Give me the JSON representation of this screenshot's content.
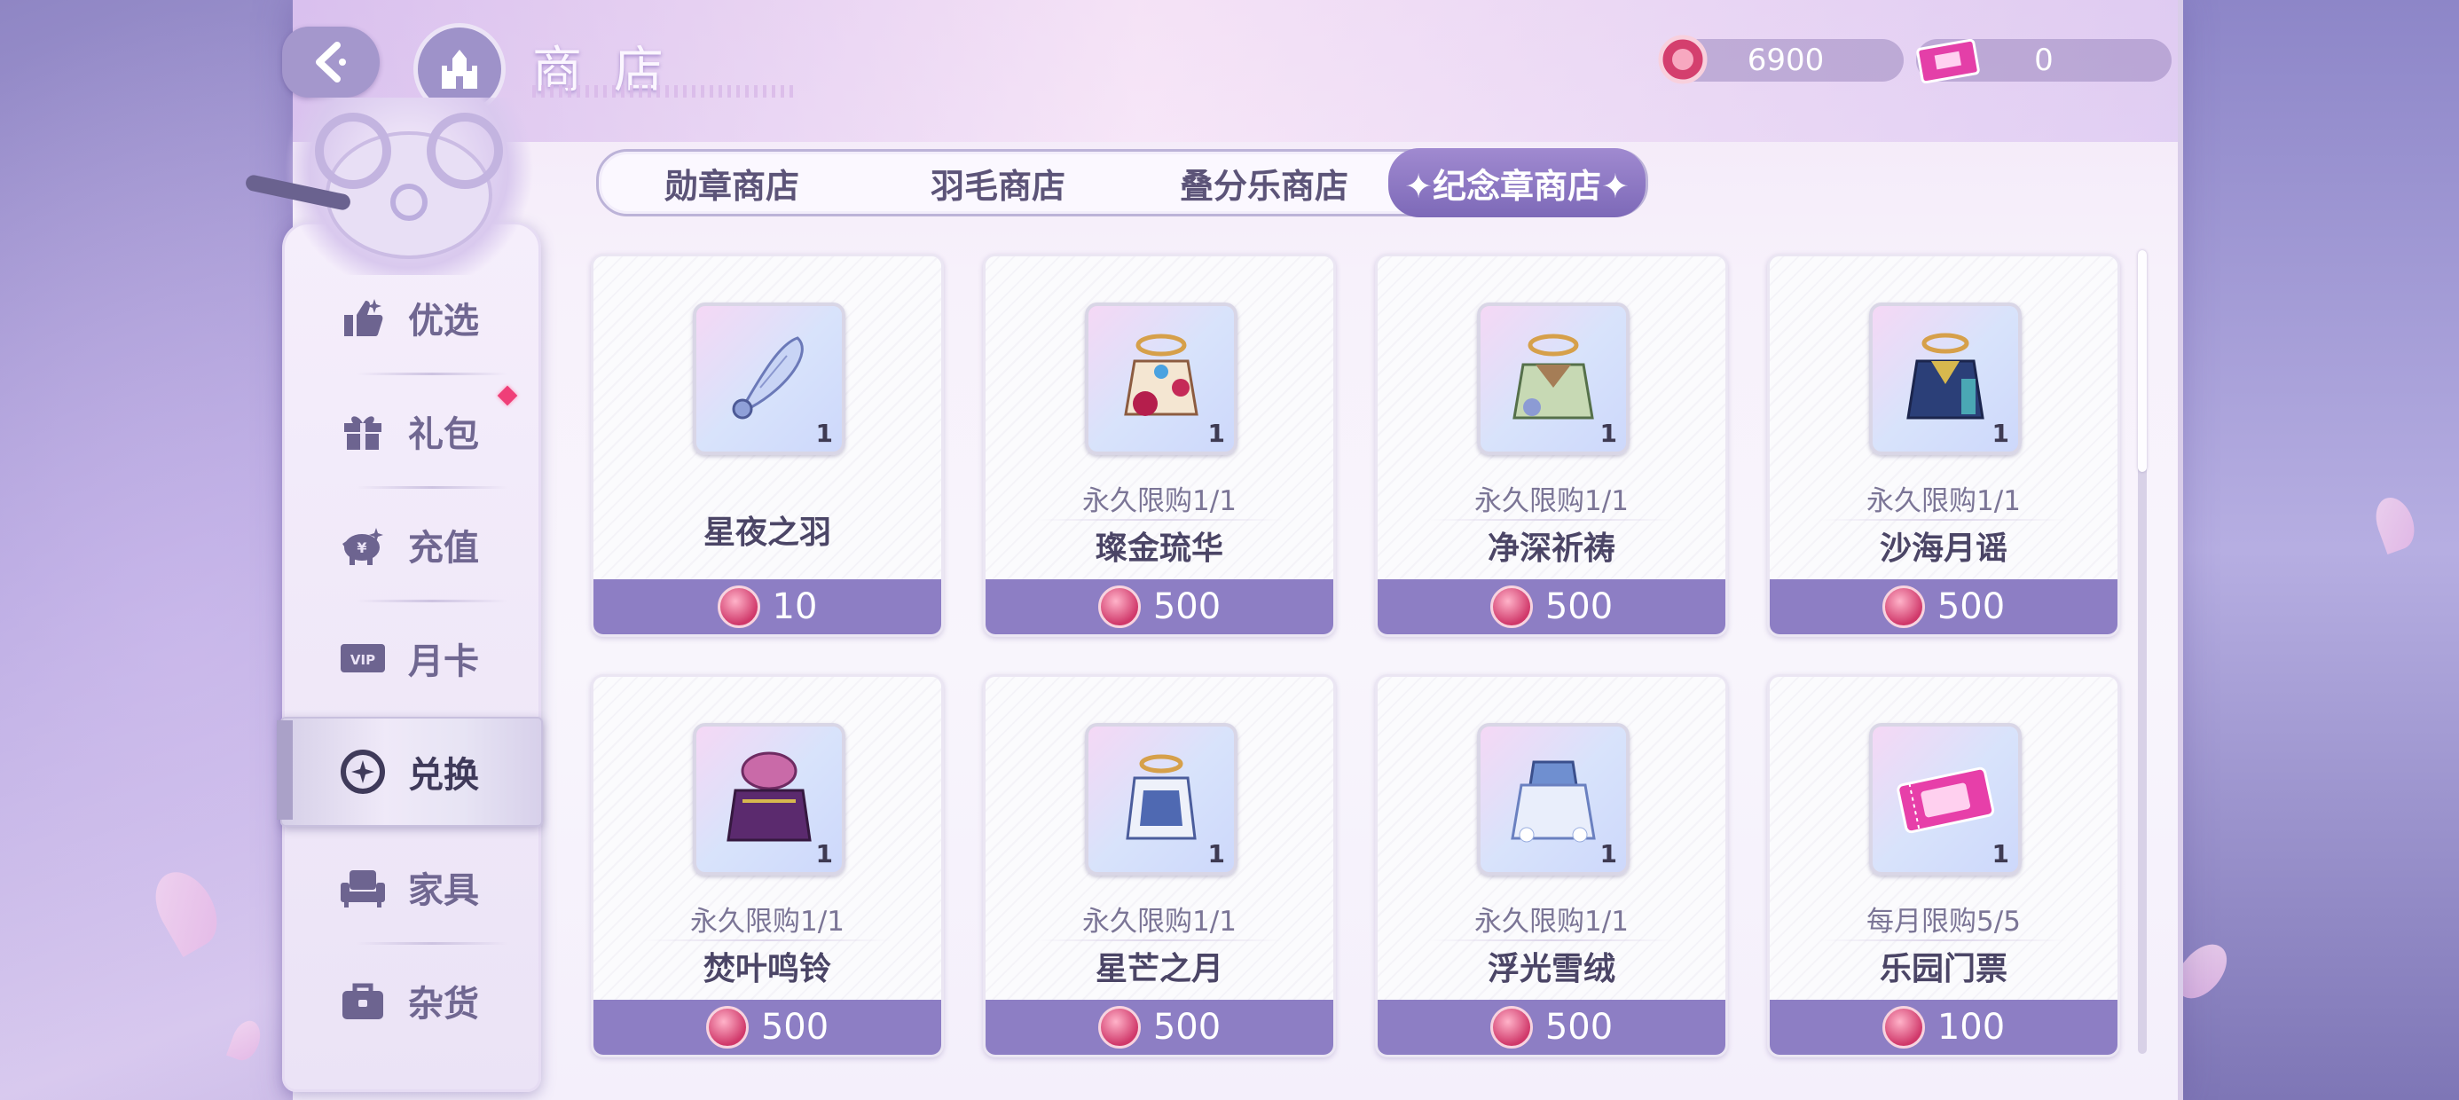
{
  "header": {
    "title": "商店",
    "currency": [
      {
        "icon": "pink-gem-coin-icon",
        "value": "6900"
      },
      {
        "icon": "ticket-icon",
        "value": "0"
      }
    ]
  },
  "sidebar": {
    "items": [
      {
        "label": "优选",
        "icon": "thumbs-up-icon"
      },
      {
        "label": "礼包",
        "icon": "gift-icon",
        "badge": true
      },
      {
        "label": "充值",
        "icon": "piggy-bank-icon"
      },
      {
        "label": "月卡",
        "icon": "vip-card-icon"
      },
      {
        "label": "兑换",
        "icon": "exchange-icon",
        "active": true
      },
      {
        "label": "家具",
        "icon": "sofa-icon"
      },
      {
        "label": "杂货",
        "icon": "bag-icon"
      }
    ]
  },
  "tabs": [
    {
      "label": "勋章商店"
    },
    {
      "label": "羽毛商店"
    },
    {
      "label": "叠分乐商店"
    },
    {
      "label": "✦纪念章商店✦",
      "active": true
    }
  ],
  "items": [
    {
      "name": "星夜之羽",
      "limit": "",
      "qty": "1",
      "price": "10",
      "icon": "feather-wand-icon"
    },
    {
      "name": "璨金琉华",
      "limit": "永久限购1/1",
      "qty": "1",
      "price": "500",
      "icon": "gold-outfit-icon"
    },
    {
      "name": "净深祈祷",
      "limit": "永久限购1/1",
      "qty": "1",
      "price": "500",
      "icon": "green-outfit-icon"
    },
    {
      "name": "沙海月谣",
      "limit": "永久限购1/1",
      "qty": "1",
      "price": "500",
      "icon": "navy-outfit-icon"
    },
    {
      "name": "焚叶鸣铃",
      "limit": "永久限购1/1",
      "qty": "1",
      "price": "500",
      "icon": "purple-dress-icon"
    },
    {
      "name": "星芒之月",
      "limit": "永久限购1/1",
      "qty": "1",
      "price": "500",
      "icon": "blue-white-outfit-icon"
    },
    {
      "name": "浮光雪绒",
      "limit": "永久限购1/1",
      "qty": "1",
      "price": "500",
      "icon": "snow-dress-icon"
    },
    {
      "name": "乐园门票",
      "limit": "每月限购5/5",
      "qty": "1",
      "price": "100",
      "icon": "dreamland-ticket-icon"
    }
  ],
  "colors": {
    "accent": "#8d7ec4",
    "tab_active": "#7d69b8",
    "badge": "#ef3f78",
    "text": "#4b4566"
  }
}
